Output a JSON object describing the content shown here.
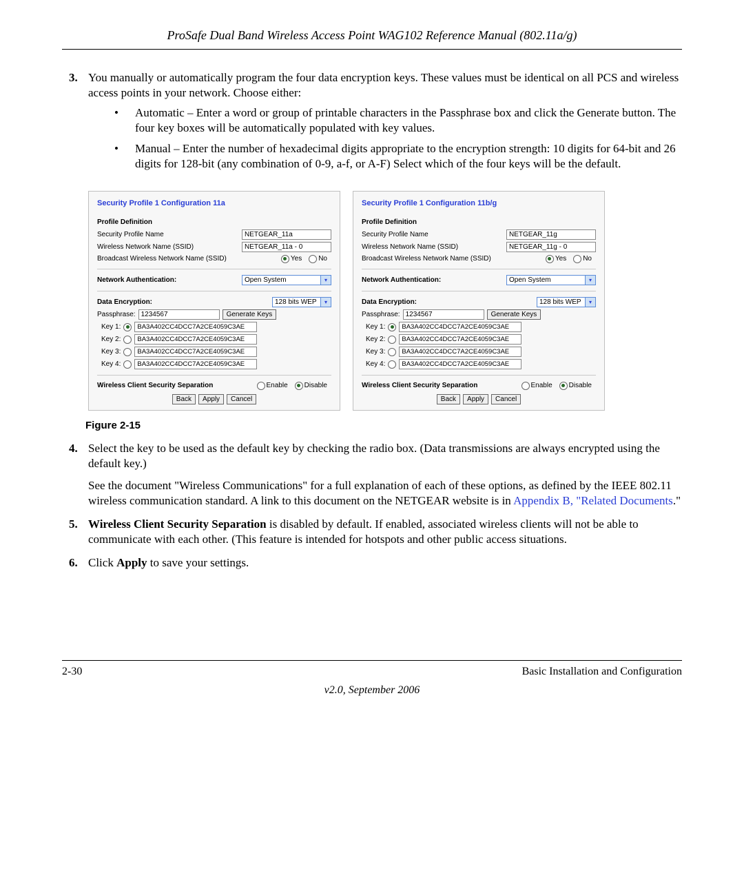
{
  "header": "ProSafe Dual Band Wireless Access Point WAG102 Reference Manual (802.11a/g)",
  "step3": {
    "num": "3.",
    "text": "You manually or automatically program the four data encryption keys. These values must be identical on all PCS and wireless access points in your network. Choose either:",
    "bulletA": "Automatic – Enter a word or group of printable characters in the Passphrase box and click the Generate button. The four key boxes will be automatically populated with key values.",
    "bulletB": "Manual – Enter the number of hexadecimal digits appropriate to the encryption strength: 10 digits for 64-bit and 26 digits for 128-bit (any combination of 0-9, a-f, or A-F) Select which of the four keys will be the default."
  },
  "figcaption": "Figure 2-15",
  "panelLeft": {
    "title": "Security Profile 1 Configuration 11a",
    "profileName": "NETGEAR_11a",
    "ssid": "NETGEAR_11a - 0"
  },
  "panelRight": {
    "title": "Security Profile 1 Configuration 11b/g",
    "profileName": "NETGEAR_11g",
    "ssid": "NETGEAR_11g - 0"
  },
  "labels": {
    "profileDef": "Profile Definition",
    "secProfName": "Security Profile Name",
    "wlanName": "Wireless Network Name (SSID)",
    "broadcast": "Broadcast Wireless Network Name (SSID)",
    "yes": "Yes",
    "no": "No",
    "netAuth": "Network Authentication:",
    "openSys": "Open System",
    "dataEnc": "Data Encryption:",
    "wep128": "128 bits WEP",
    "passphrase": "Passphrase:",
    "passval": "1234567",
    "genkeys": "Generate Keys",
    "key1": "Key 1:",
    "key2": "Key 2:",
    "key3": "Key 3:",
    "key4": "Key 4:",
    "keyval": "BA3A402CC4DCC7A2CE4059C3AE",
    "wcss": "Wireless Client Security Separation",
    "enable": "Enable",
    "disable": "Disable",
    "back": "Back",
    "apply": "Apply",
    "cancel": "Cancel"
  },
  "step4": {
    "num": "4.",
    "p1": "Select the key to be used as the default key by checking the radio box. (Data transmissions are always encrypted using the default key.)",
    "p2a": "See the document \"Wireless Communications\" for a full explanation of each of these options, as defined by the IEEE 802.11 wireless communication standard. A link to this document on the NETGEAR website is in ",
    "p2link": "Appendix B, \"Related Documents",
    "p2b": ".\""
  },
  "step5": {
    "num": "5.",
    "lead": "Wireless Client Security Separation",
    "rest": " is disabled by default. If enabled, associated wireless clients will not be able to communicate with each other. (This feature is intended for hotspots and other public access situations."
  },
  "step6": {
    "num": "6.",
    "lead": "Click ",
    "bold": "Apply",
    "rest": " to save your settings."
  },
  "footer": {
    "left": "2-30",
    "right": "Basic Installation and Configuration",
    "bottom": "v2.0, September 2006"
  }
}
